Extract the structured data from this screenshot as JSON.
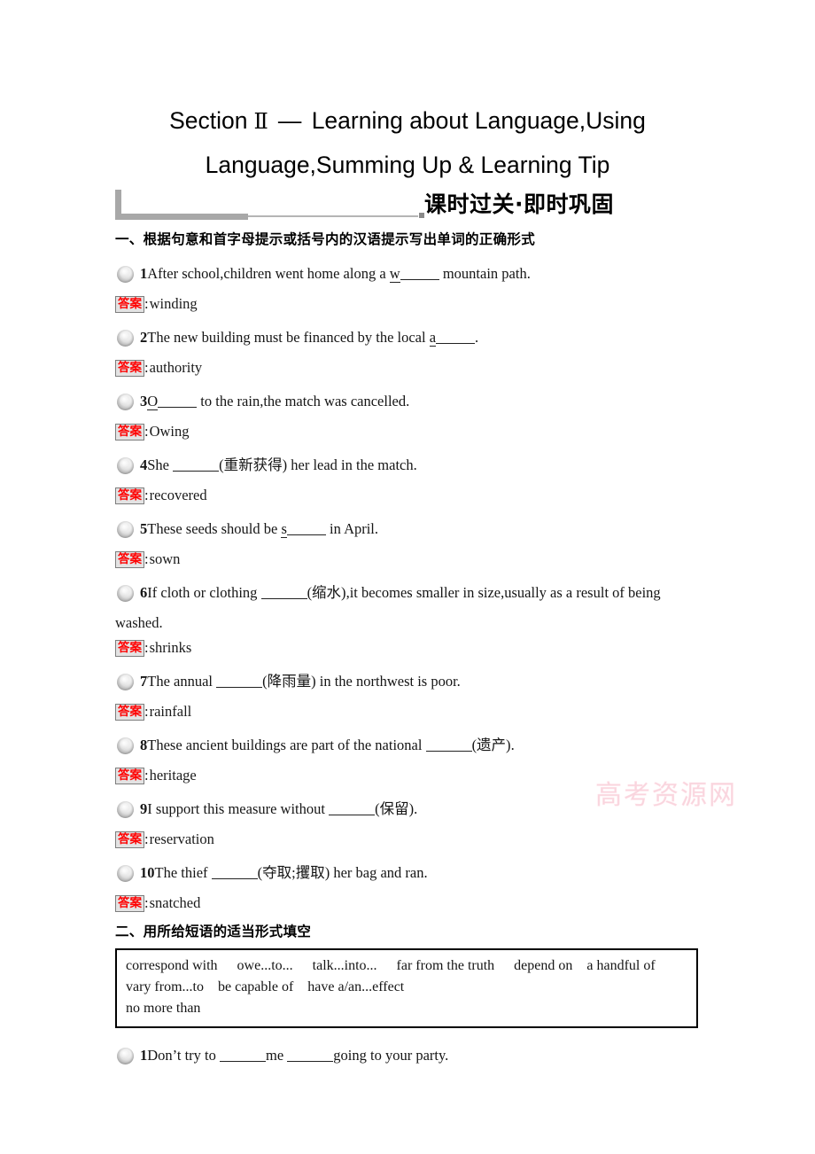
{
  "document": {
    "title_lines": [
      {
        "prefix": "Section",
        "roman": "Ⅱ",
        "dash": "—",
        "rest": "Learning about Language,Using"
      },
      {
        "text": "Language,Summing Up & Learning Tip"
      }
    ],
    "banner": "课时过关·即时巩固",
    "watermark": "高考资源网"
  },
  "sections": [
    {
      "heading": "一、根据句意和首字母提示或括号内的汉语提示写出单词的正确形式",
      "answer_label": "答案",
      "answer_sep": ":",
      "items": [
        {
          "num": "1",
          "text_before": "After school,children went home along a ",
          "hint_letter": "w",
          "text_after": " mountain path.",
          "answer": "winding"
        },
        {
          "num": "2",
          "text_before": "The new building must be financed by the local ",
          "hint_letter": "a",
          "text_after": ".",
          "answer": "authority"
        },
        {
          "num": "3",
          "text_before": "",
          "hint_letter": "O",
          "text_after": " to the rain,the match was cancelled.",
          "answer": "Owing"
        },
        {
          "num": "4",
          "text_before": "She ",
          "blank": true,
          "paren": "(重新获得)",
          "text_after": " her lead in the match.",
          "answer": "recovered"
        },
        {
          "num": "5",
          "text_before": "These seeds should be ",
          "hint_letter": "s",
          "text_after": " in April.",
          "answer": "sown"
        },
        {
          "num": "6",
          "text_before": "If cloth or clothing ",
          "blank": true,
          "paren": "(缩水)",
          "text_after": ",it becomes smaller in size,usually as a result of being",
          "continuation": "washed.",
          "answer": "shrinks"
        },
        {
          "num": "7",
          "text_before": "The annual ",
          "blank": true,
          "paren": "(降雨量)",
          "text_after": " in the northwest is poor.",
          "answer": "rainfall"
        },
        {
          "num": "8",
          "text_before": "These ancient buildings are part of the national ",
          "blank": true,
          "paren": "(遗产)",
          "text_after": ".",
          "answer": "heritage"
        },
        {
          "num": "9",
          "text_before": "I support this measure without ",
          "blank": true,
          "paren": "(保留)",
          "text_after": ".",
          "answer": "reservation"
        },
        {
          "num": "10",
          "text_before": "The thief ",
          "blank": true,
          "paren": "(夺取;攫取)",
          "text_after": " her bag and ran.",
          "answer": "snatched"
        }
      ]
    },
    {
      "heading": "二、用所给短语的适当形式填空",
      "phrase_box_lines": [
        [
          "correspond with",
          "owe...to...",
          "talk...into...",
          "far from the truth",
          "depend on",
          "a handful of"
        ],
        [
          "vary from...to",
          "be capable of",
          "have a/an...effect"
        ],
        [
          "no more than"
        ]
      ],
      "items": [
        {
          "num": "1",
          "text_before": "Don’t try to ",
          "blank": true,
          "middle": "me ",
          "blank2": true,
          "text_after": "going to your party."
        }
      ]
    }
  ]
}
